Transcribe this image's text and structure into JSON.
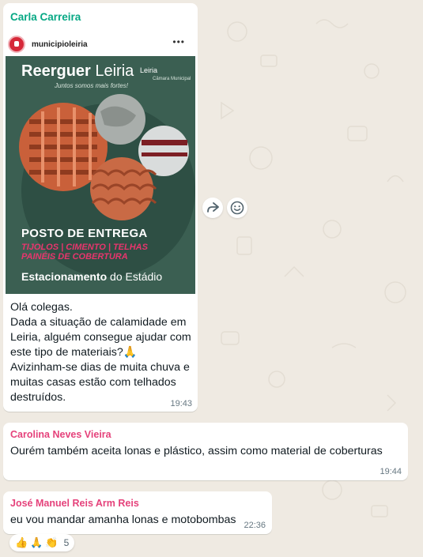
{
  "messages": [
    {
      "sender": "Carla Carreira",
      "sender_color": "#06a884",
      "post": {
        "username": "municipioleiria",
        "more": "•••",
        "brand_bold": "Reerguer",
        "brand_rest": " Leiria",
        "tagline": "Juntos somos mais fortes!",
        "city": "Leiria",
        "city_sub": "Câmara Municipal",
        "headline": "POSTO DE ENTREGA",
        "materials": "TIJOLOS | CIMENTO | TELHAS\nPAINÉIS DE COBERTURA",
        "location_bold": "Estacionamento",
        "location_rest": " do Estádio"
      },
      "text": "Olá colegas.\nDada a situação de calamidade em Leiria, alguém consegue ajudar com este tipo de materiais?🙏\nAvizinham-se dias de muita chuva e muitas casas estão com telhados destruídos.",
      "time": "19:43"
    },
    {
      "sender": "Carolina Neves Vieira",
      "sender_color": "#e5427b",
      "text": "Ourém também aceita lonas e plástico, assim como material de coberturas",
      "time": "19:44"
    },
    {
      "sender": "José Manuel Reis Arm Reis",
      "sender_color": "#e5427b",
      "text": "eu vou mandar amanha lonas e motobombas",
      "time": "22:36"
    }
  ],
  "reactions": {
    "emojis": [
      "👍",
      "🙏",
      "👏"
    ],
    "count": "5"
  },
  "icons": {
    "forward": "forward-icon",
    "emoji": "emoji-icon"
  }
}
